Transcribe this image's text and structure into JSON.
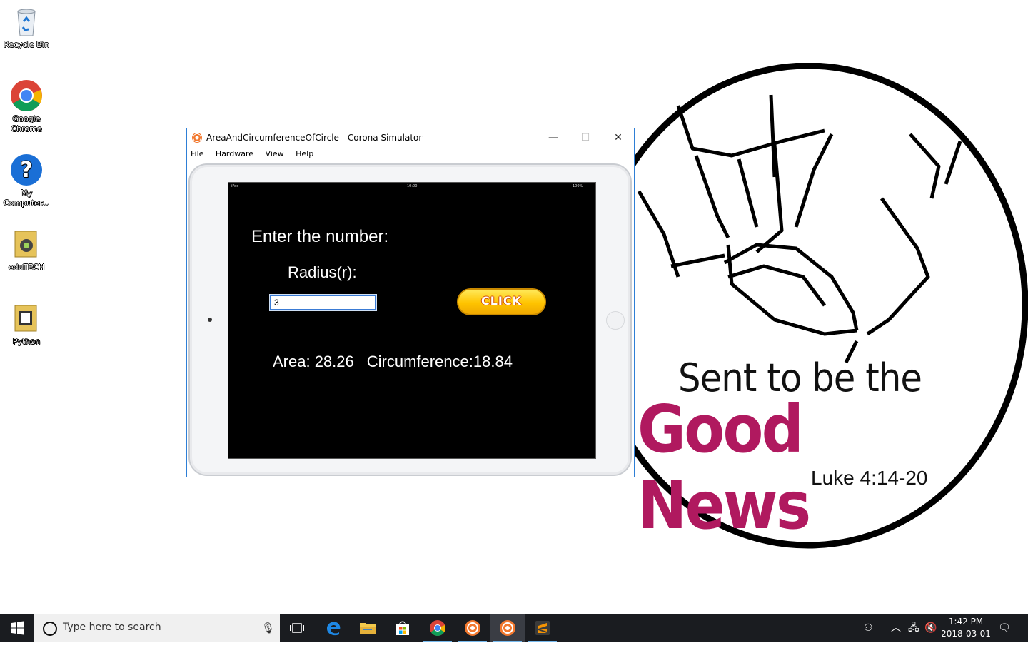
{
  "desktop": {
    "icons": [
      {
        "label": "Recycle Bin"
      },
      {
        "label": "Google Chrome"
      },
      {
        "label": "My Computer..."
      },
      {
        "label": "eduTECH"
      },
      {
        "label": "Python"
      }
    ]
  },
  "wallpaper": {
    "line1": "Sent to be the",
    "line2": "Good News",
    "line3": "Luke 4:14-20",
    "accent_color": "#b0195f"
  },
  "window": {
    "title": "AreaAndCircumferenceOfCircle - Corona Simulator",
    "minimize_glyph": "—",
    "maximize_glyph": "☐",
    "close_glyph": "✕",
    "menu": [
      "File",
      "Hardware",
      "View",
      "Help"
    ]
  },
  "device": {
    "status_left": "iPad",
    "status_center": "10:00",
    "status_right": "100%",
    "prompt": "Enter the number:",
    "radius_label": "Radius(r):",
    "radius_value": "3",
    "button_label": "CLICK",
    "area_text": "Area: 28.26",
    "circumference_text": "Circumference:18.84"
  },
  "taskbar": {
    "search_placeholder": "Type here to search",
    "clock_time": "1:42 PM",
    "clock_date": "2018-03-01",
    "apps": [
      "task-view",
      "edge",
      "file-explorer",
      "store",
      "chrome",
      "corona",
      "corona-simulator",
      "sublime-text"
    ],
    "active_app": "corona-simulator"
  }
}
